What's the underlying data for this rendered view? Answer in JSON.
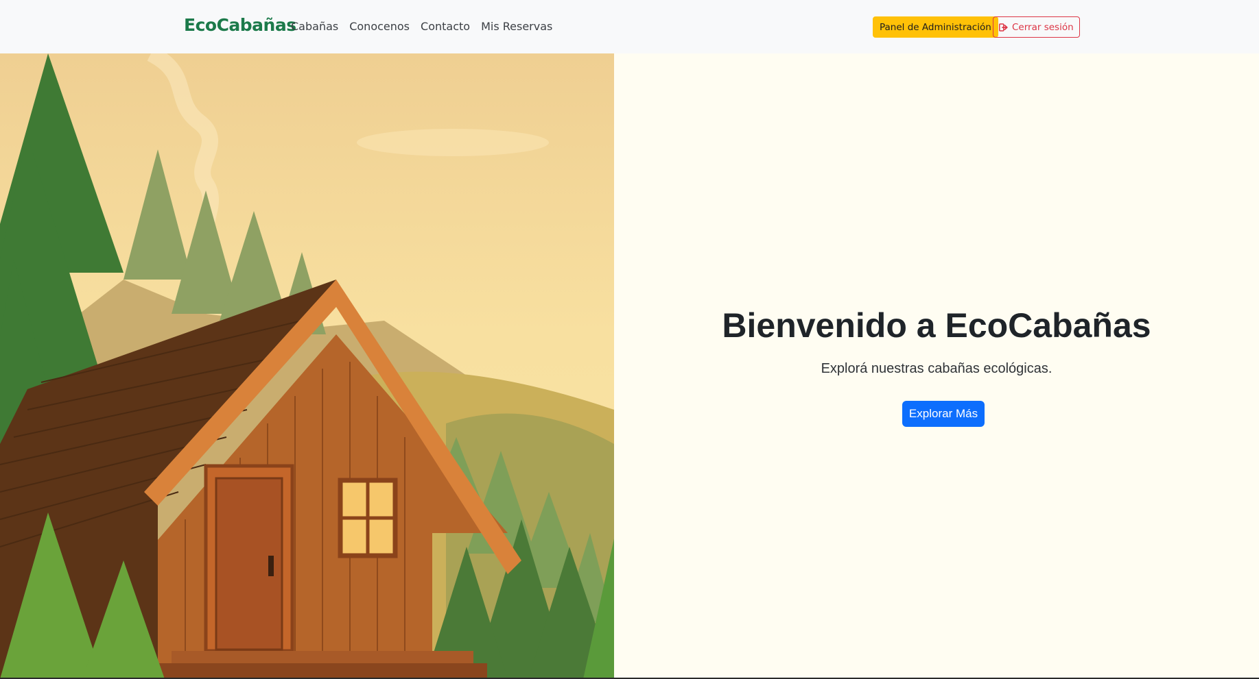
{
  "nav": {
    "brand": "EcoCabañas",
    "links": [
      "Cabañas",
      "Conocenos",
      "Contacto",
      "Mis Reservas"
    ],
    "admin_button": "Panel de Administración",
    "logout_button": "Cerrar sesión"
  },
  "hero": {
    "title": "Bienvenido a EcoCabañas",
    "subtitle": "Explorá nuestras cabañas ecológicas.",
    "cta": "Explorar Más"
  },
  "colors": {
    "brand": "#1c7a4a",
    "admin": "#ffc107",
    "logout": "#dc3545",
    "primary": "#0d6efd",
    "hero_bg": "#fffdf2"
  },
  "icons": {
    "logout": "sign-out-icon",
    "illustration": "cabin-forest-illustration"
  }
}
